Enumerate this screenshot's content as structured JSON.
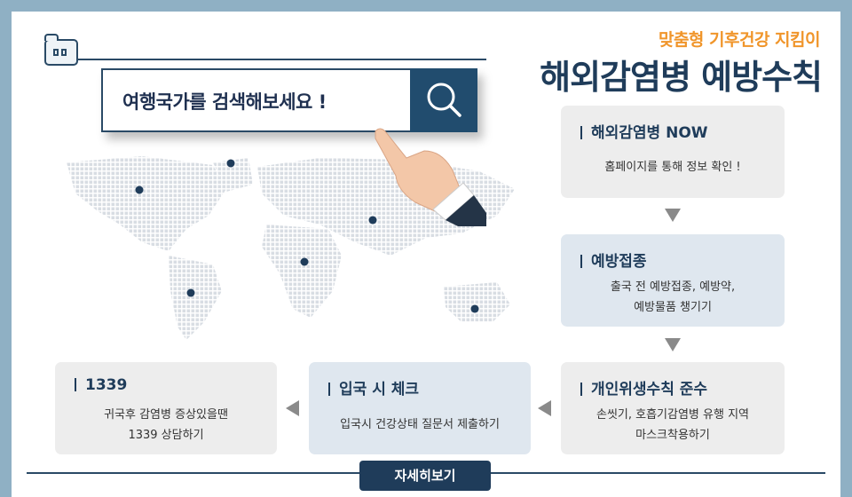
{
  "header": {
    "subtitle": "맞춤형 기후건강 지킴이",
    "title": "해외감염병 예방수칙"
  },
  "search": {
    "prompt": "여행국가를 검색해보세요 !",
    "icon": "search-icon"
  },
  "cards": [
    {
      "title": "해외감염병 NOW",
      "lines": [
        "홈페이지를 통해 정보 확인 !"
      ]
    },
    {
      "title": "예방접종",
      "lines": [
        "출국 전 예방접종, 예방약,",
        "예방물품 챙기기"
      ]
    },
    {
      "title": "개인위생수칙 준수",
      "lines": [
        "손씻기, 호흡기감염병 유행 지역",
        "마스크착용하기"
      ]
    },
    {
      "title": "입국 시 체크",
      "lines": [
        "입국시 건강상태 질문서 제출하기"
      ]
    },
    {
      "title": "1339",
      "lines": [
        "귀국후 감염병 증상있을땐",
        "1339 상담하기"
      ]
    }
  ],
  "footer": {
    "more_label": "자세히보기"
  },
  "colors": {
    "navy": "#1f3c5a",
    "accent": "#f0952a",
    "border": "#8fb0c4"
  }
}
